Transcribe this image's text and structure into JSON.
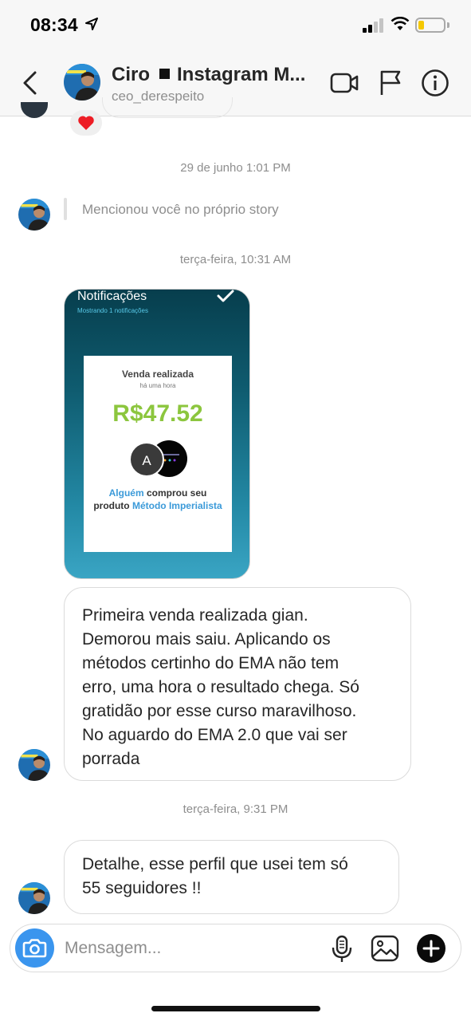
{
  "status_bar": {
    "time": "08:34"
  },
  "header": {
    "name": "Ciro",
    "subtitle_name": "Instagram M...",
    "username": "ceo_derespeito"
  },
  "messages": {
    "reaction": "❤️",
    "timestamp_1": "29 de junho 1:01 PM",
    "mention": "Mencionou você no próprio story",
    "timestamp_2": "terça-feira, 10:31 AM",
    "story": {
      "header_title": "Notificações",
      "header_sub": "Mostrando 1 notificações",
      "sale_title": "Venda realizada",
      "sale_time": "há uma hora",
      "amount": "R$47.52",
      "buyer_initial": "A",
      "desc_who": "Alguém",
      "desc_mid": "comprou seu produto",
      "desc_product": "Método Imperialista"
    },
    "bubble_1": "Primeira venda realizada gian.\nDemorou mais saiu. Aplicando os\nmétodos certinho do EMA não tem\nerro, uma hora o resultado chega. Só\ngratidão por esse curso maravilhoso.\nNo aguardo do EMA 2.0 que vai ser\nporrada",
    "timestamp_3": "terça-feira, 9:31 PM",
    "bubble_2": "Detalhe, esse perfil que usei tem só\n55 seguidores !!"
  },
  "composer": {
    "placeholder": "Mensagem..."
  },
  "colors": {
    "accent_blue": "#3a95ee",
    "sale_green": "#8cc63e",
    "link_blue": "#3b9ad9"
  },
  "icons": [
    "back-icon",
    "video-icon",
    "flag-icon",
    "info-icon",
    "camera-icon",
    "mic-icon",
    "gallery-icon",
    "plus-icon"
  ]
}
